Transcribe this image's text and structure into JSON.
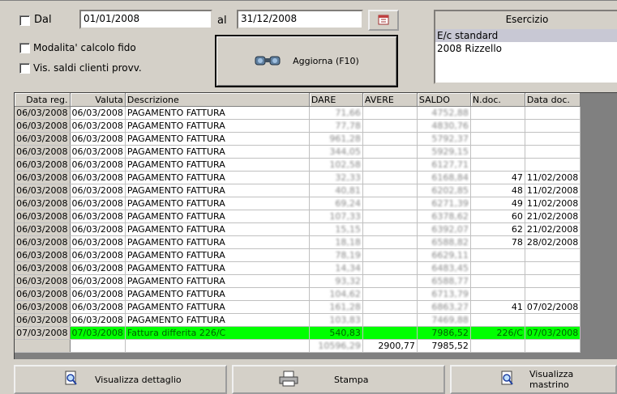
{
  "filter": {
    "dal_label": "Dal",
    "date_from": "01/01/2008",
    "al_label": "al",
    "date_to": "31/12/2008",
    "modalita_label": "Modalita' calcolo fido",
    "vis_saldi_label": "Vis. saldi clienti provv."
  },
  "refresh_button": {
    "label": "Aggiorna (F10)"
  },
  "esercizio": {
    "title": "Esercizio",
    "items": [
      "E/c standard",
      "2008 Rizzello"
    ]
  },
  "table": {
    "headers": [
      "Data reg.",
      "Valuta",
      "Descrizione",
      "DARE",
      "AVERE",
      "SALDO",
      "N.doc.",
      "Data doc."
    ],
    "rows": [
      [
        "06/03/2008",
        "06/03/2008",
        "PAGAMENTO FATTURA",
        "71,66",
        "",
        "4752,88",
        "",
        ""
      ],
      [
        "06/03/2008",
        "06/03/2008",
        "PAGAMENTO FATTURA",
        "77,78",
        "",
        "4830,76",
        "",
        ""
      ],
      [
        "06/03/2008",
        "06/03/2008",
        "PAGAMENTO FATTURA",
        "961,28",
        "",
        "5792,37",
        "",
        ""
      ],
      [
        "06/03/2008",
        "06/03/2008",
        "PAGAMENTO FATTURA",
        "344,05",
        "",
        "5929,15",
        "",
        ""
      ],
      [
        "06/03/2008",
        "06/03/2008",
        "PAGAMENTO FATTURA",
        "102,58",
        "",
        "6127,71",
        "",
        ""
      ],
      [
        "06/03/2008",
        "06/03/2008",
        "PAGAMENTO FATTURA",
        "32,33",
        "",
        "6168,84",
        "47",
        "11/02/2008"
      ],
      [
        "06/03/2008",
        "06/03/2008",
        "PAGAMENTO FATTURA",
        "40,81",
        "",
        "6202,85",
        "48",
        "11/02/2008"
      ],
      [
        "06/03/2008",
        "06/03/2008",
        "PAGAMENTO FATTURA",
        "69,24",
        "",
        "6271,39",
        "49",
        "11/02/2008"
      ],
      [
        "06/03/2008",
        "06/03/2008",
        "PAGAMENTO FATTURA",
        "107,33",
        "",
        "6378,62",
        "60",
        "21/02/2008"
      ],
      [
        "06/03/2008",
        "06/03/2008",
        "PAGAMENTO FATTURA",
        "15,15",
        "",
        "6392,07",
        "62",
        "21/02/2008"
      ],
      [
        "06/03/2008",
        "06/03/2008",
        "PAGAMENTO FATTURA",
        "18,18",
        "",
        "6588,82",
        "78",
        "28/02/2008"
      ],
      [
        "06/03/2008",
        "06/03/2008",
        "PAGAMENTO FATTURA",
        "78,19",
        "",
        "6629,11",
        "",
        ""
      ],
      [
        "06/03/2008",
        "06/03/2008",
        "PAGAMENTO FATTURA",
        "14,34",
        "",
        "6483,45",
        "",
        ""
      ],
      [
        "06/03/2008",
        "06/03/2008",
        "PAGAMENTO FATTURA",
        "93,32",
        "",
        "6588,77",
        "",
        ""
      ],
      [
        "06/03/2008",
        "06/03/2008",
        "PAGAMENTO FATTURA",
        "104,62",
        "",
        "6713,79",
        "",
        ""
      ],
      [
        "06/03/2008",
        "06/03/2008",
        "PAGAMENTO FATTURA",
        "161,28",
        "",
        "6863,27",
        "41",
        "07/02/2008"
      ],
      [
        "06/03/2008",
        "06/03/2008",
        "PAGAMENTO FATTURA",
        "103,83",
        "",
        "7469,88",
        "",
        ""
      ],
      [
        "07/03/2008",
        "07/03/2008",
        "Fattura differita 226/C",
        "540,83",
        "",
        "7986,52",
        "226/C",
        "07/03/2008"
      ]
    ],
    "totals": [
      "",
      "",
      "",
      "10596,29",
      "2900,77",
      "7985,52",
      "",
      ""
    ]
  },
  "bottom_buttons": {
    "dettaglio": "Visualizza dettaglio",
    "stampa": "Stampa",
    "mastrino": "Visualizza mastrino"
  }
}
